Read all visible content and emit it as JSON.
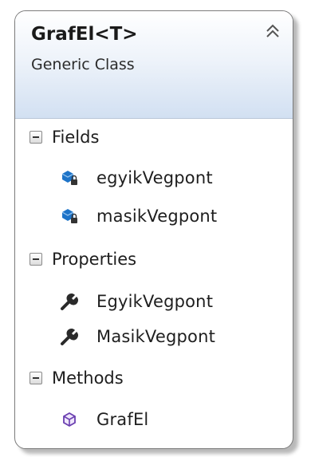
{
  "class_box": {
    "name": "GrafEl<T>",
    "kind": "Generic Class",
    "collapse_icon": "double-chevron-up-icon"
  },
  "sections": [
    {
      "label": "Fields",
      "members": [
        {
          "name": "egyikVegpont",
          "icon": "private-field-icon"
        },
        {
          "name": "masikVegpont",
          "icon": "private-field-icon"
        }
      ]
    },
    {
      "label": "Properties",
      "members": [
        {
          "name": "EgyikVegpont",
          "icon": "wrench-property-icon"
        },
        {
          "name": "MasikVegpont",
          "icon": "wrench-property-icon"
        }
      ]
    },
    {
      "label": "Methods",
      "members": [
        {
          "name": "GrafEl",
          "icon": "method-cube-icon"
        }
      ]
    }
  ],
  "colors": {
    "field_icon": "#1e74c8",
    "method_icon": "#6a3fb0",
    "header_gradient_end": "#d2e0f2"
  }
}
